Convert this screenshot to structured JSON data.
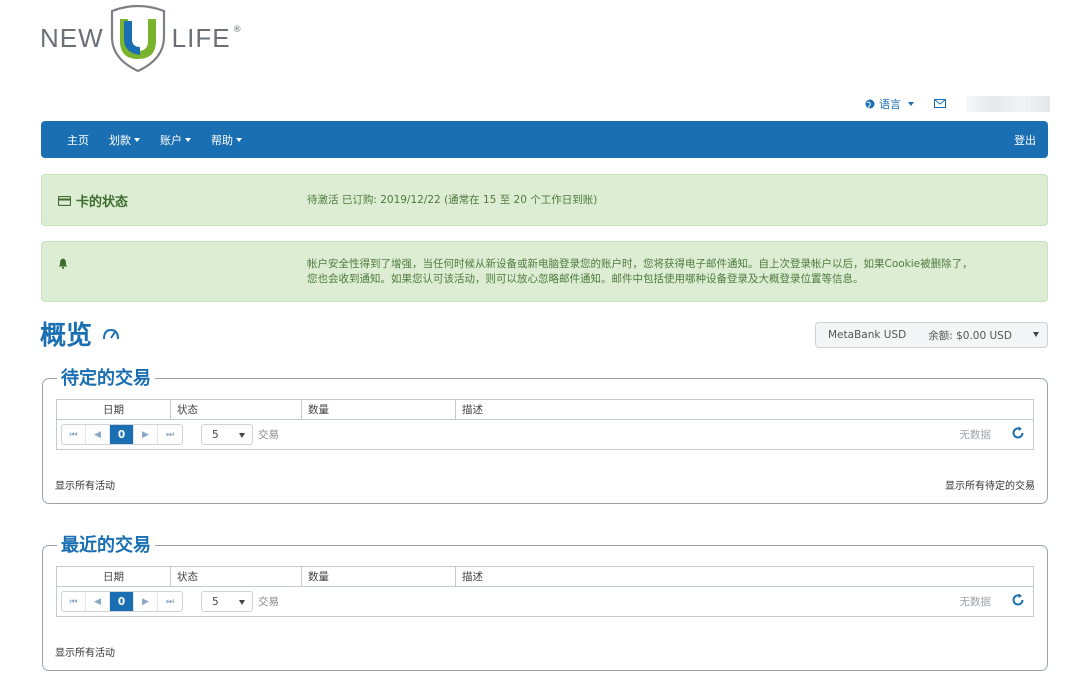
{
  "brand": {
    "left": "NEW",
    "right": "LIFE",
    "reg": "®"
  },
  "util": {
    "language": "语言"
  },
  "nav": {
    "home": "主页",
    "transfer": "划款",
    "account": "账户",
    "help": "帮助",
    "logout": "登出"
  },
  "alerts": {
    "card_status_title": "卡的状态",
    "card_status_text": "待激活 已订购: 2019/12/22 (通常在 15 至 20 个工作日到账)",
    "security_line1": "帐户安全性得到了增强，当任何时候从新设备或新电脑登录您的账户时，您将获得电子邮件通知。自上次登录帐户以后，如果Cookie被删除了，",
    "security_line2": "您也会收到通知。如果您认可该活动，则可以放心忽略邮件通知。邮件中包括使用哪种设备登录及大概登录位置等信息。"
  },
  "overview": {
    "title": "概览",
    "account_name": "MetaBank USD",
    "balance": "余额: $0.00 USD"
  },
  "pending": {
    "title": "待定的交易",
    "columns": [
      "日期",
      "状态",
      "数量",
      "描述"
    ],
    "page": "0",
    "page_size": "5",
    "page_label": "交易",
    "no_data": "无数据",
    "show_all": "显示所有活动",
    "show_pending": "显示所有待定的交易"
  },
  "recent": {
    "title": "最近的交易",
    "columns": [
      "日期",
      "状态",
      "数量",
      "描述"
    ],
    "page": "0",
    "page_size": "5",
    "page_label": "交易",
    "no_data": "无数据",
    "show_all": "显示所有活动"
  },
  "colors": {
    "primary": "#1a6fb3",
    "alert_bg": "#dcedd3",
    "alert_text": "#3e6d2f"
  }
}
